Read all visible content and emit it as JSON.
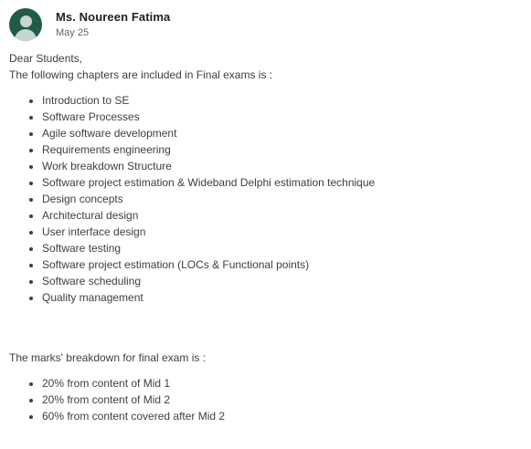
{
  "post": {
    "author": "Ms. Noureen Fatima",
    "date": "May 25"
  },
  "body": {
    "greeting": "Dear Students,",
    "intro": "The following chapters are included in Final exams is :",
    "chapters": [
      "Introduction to SE",
      "Software Processes",
      "Agile software development",
      "Requirements engineering",
      "Work breakdown Structure",
      "Software project estimation & Wideband Delphi estimation technique",
      "Design concepts",
      "Architectural design",
      "User interface design",
      "Software testing",
      "Software project estimation (LOCs & Functional points)",
      "Software scheduling",
      "Quality management"
    ],
    "marks_intro": "The marks' breakdown for final exam is :",
    "marks": [
      "20% from content of Mid 1",
      "20% from content of Mid 2",
      "60% from content covered after Mid 2"
    ]
  },
  "colors": {
    "avatar_bg": "#1f5c4a",
    "text": "#3c4043",
    "author": "#202124",
    "date": "#5f6368"
  },
  "icons": {
    "avatar": "person-icon"
  }
}
